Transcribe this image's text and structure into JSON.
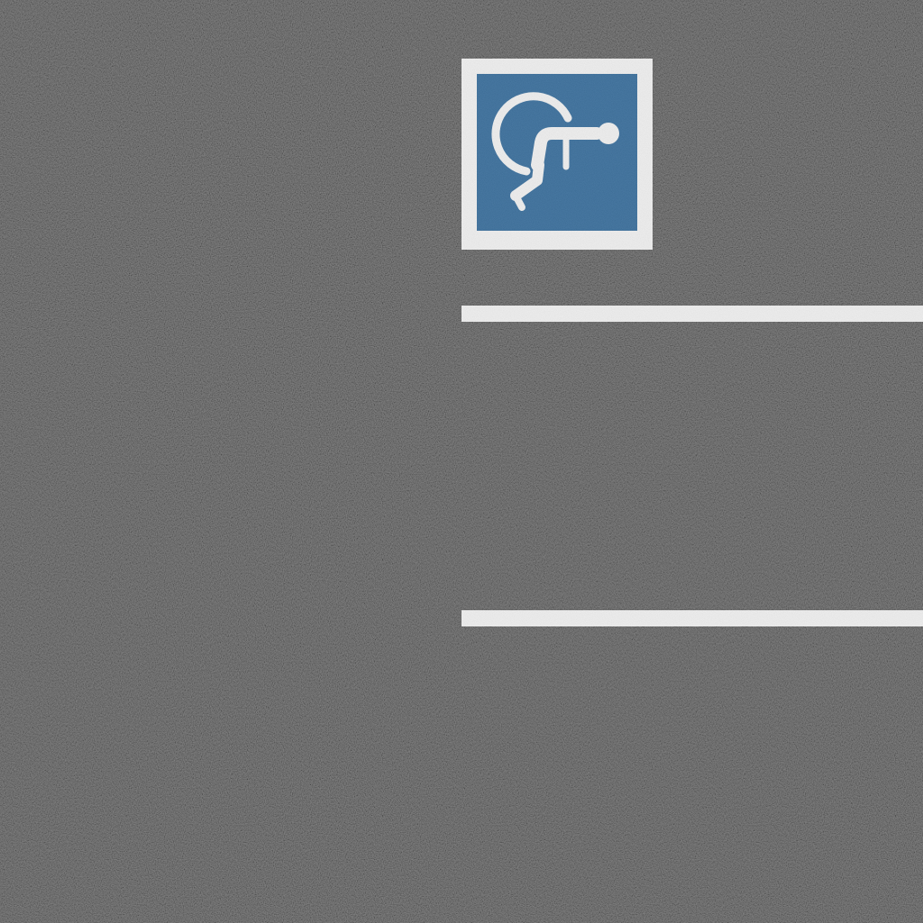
{
  "scene": {
    "surface": "asphalt",
    "colors": {
      "asphalt": "#4a4a4a",
      "paint_white": "#f2f2f2",
      "sign_blue": "#2a6496"
    }
  },
  "accessibility_marking": {
    "icon": "wheelchair-icon",
    "colors": {
      "background": "#2a6496",
      "border": "#f2f2f2",
      "symbol": "#f2f2f2"
    }
  },
  "parking_lines": {
    "count": 2,
    "color": "#f2f2f2"
  }
}
